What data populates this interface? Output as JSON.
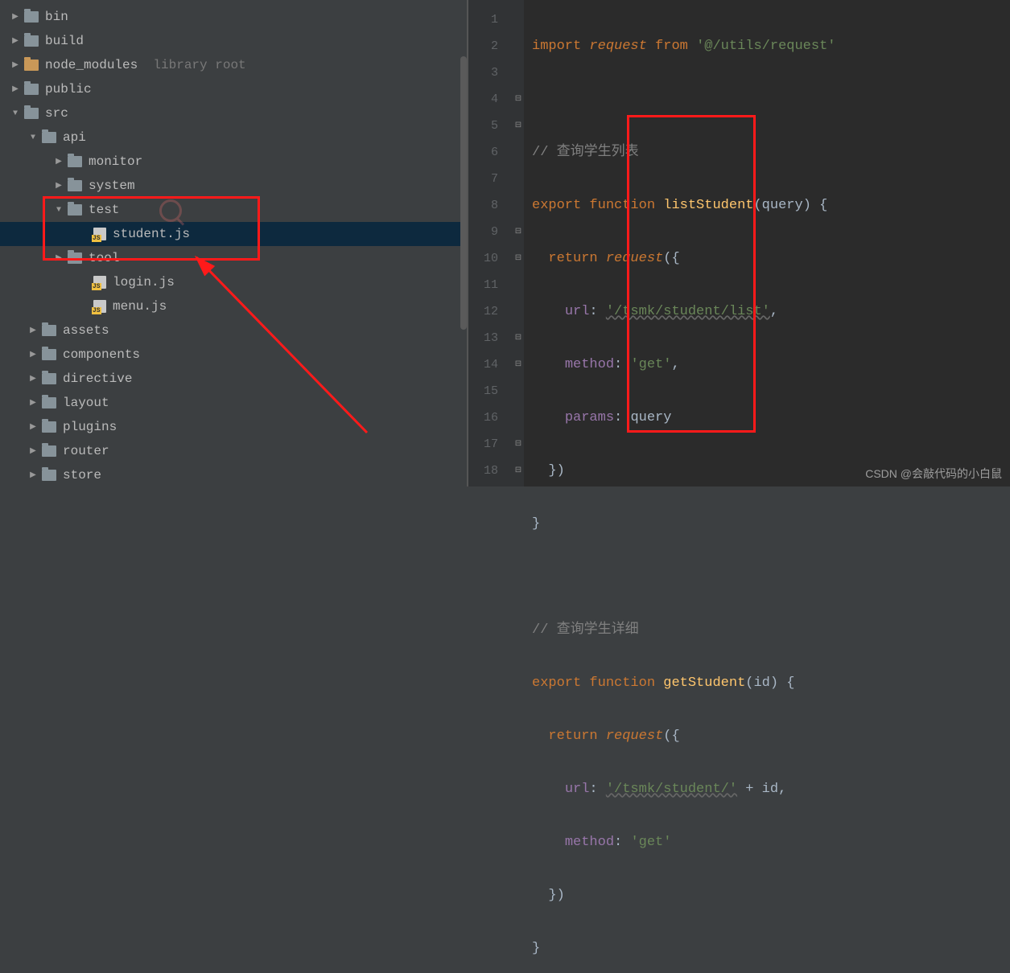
{
  "tree": {
    "bin": "bin",
    "build": "build",
    "node_modules": "node_modules",
    "node_modules_hint": "library root",
    "public": "public",
    "src": "src",
    "api": "api",
    "monitor": "monitor",
    "system": "system",
    "test": "test",
    "student_js": "student.js",
    "tool": "tool",
    "login_js": "login.js",
    "menu_js": "menu.js",
    "assets": "assets",
    "components": "components",
    "directive": "directive",
    "layout": "layout",
    "plugins": "plugins",
    "router": "router",
    "store": "store"
  },
  "code": {
    "l1_import": "import",
    "l1_request": "request",
    "l1_from": "from",
    "l1_path": "'@/utils/request'",
    "l3_cmt": "// 查询学生列表",
    "l4_export": "export",
    "l4_function": "function",
    "l4_name": "listStudent",
    "l4_param": "query",
    "l5_return": "return",
    "l5_request": "request",
    "l6_key": "url",
    "l6_val": "'/tsmk/student/list'",
    "l7_key": "method",
    "l7_val": "'get'",
    "l8_key": "params",
    "l8_val": "query",
    "l12_cmt": "// 查询学生详细",
    "l13_export": "export",
    "l13_function": "function",
    "l13_name": "getStudent",
    "l13_param": "id",
    "l14_return": "return",
    "l14_request": "request",
    "l15_key": "url",
    "l15_val": "'/tsmk/student/'",
    "l15_plus": " + id",
    "l16_key": "method",
    "l16_val": "'get'"
  },
  "lines": [
    "1",
    "2",
    "3",
    "4",
    "5",
    "6",
    "7",
    "8",
    "9",
    "10",
    "11",
    "12",
    "13",
    "14",
    "15",
    "16",
    "17",
    "18"
  ],
  "watermark": "CSDN @会敲代码的小白鼠"
}
